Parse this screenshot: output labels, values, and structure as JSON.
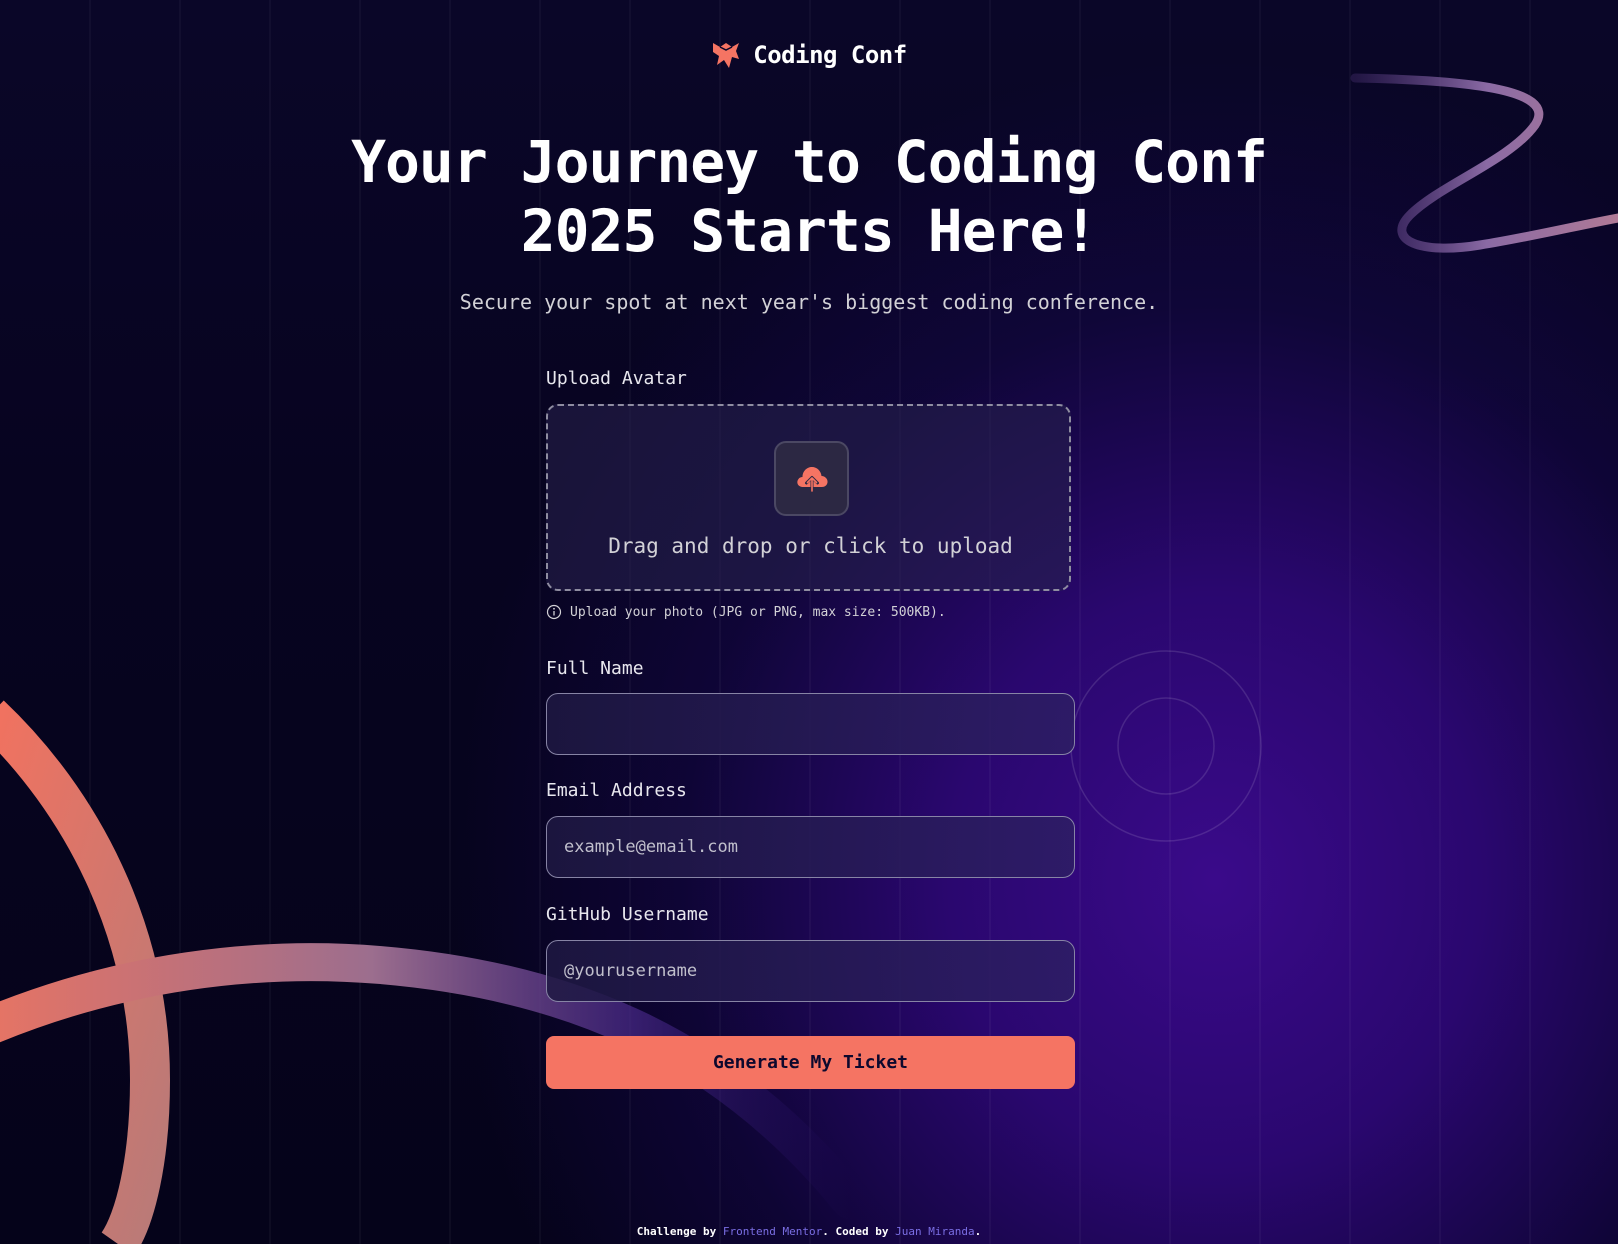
{
  "brand": {
    "name": "Coding Conf"
  },
  "hero": {
    "headline_line1": "Your Journey to Coding Conf",
    "headline_line2": "2025 Starts Here!",
    "subtitle": "Secure your spot at next year's biggest coding conference."
  },
  "form": {
    "avatar": {
      "label": "Upload Avatar",
      "dropzone_text": "Drag and drop or click to upload",
      "hint": "Upload your photo (JPG or PNG, max size: 500KB)."
    },
    "full_name": {
      "label": "Full Name",
      "value": "",
      "placeholder": ""
    },
    "email": {
      "label": "Email Address",
      "value": "",
      "placeholder": "example@email.com"
    },
    "github": {
      "label": "GitHub Username",
      "value": "",
      "placeholder": "@yourusername"
    },
    "submit_label": "Generate My Ticket"
  },
  "footer": {
    "prefix": "Challenge by ",
    "challenge_link": "Frontend Mentor",
    "middle": ". Coded by ",
    "author_link": "Juan Miranda",
    "suffix": "."
  },
  "colors": {
    "accent": "#f57463",
    "link": "#7a6ee3",
    "background": "#0a0628",
    "glow": "#3a0a8a"
  },
  "icons": {
    "logo": "conf-logo-icon",
    "upload": "cloud-upload-icon",
    "info": "info-icon"
  }
}
